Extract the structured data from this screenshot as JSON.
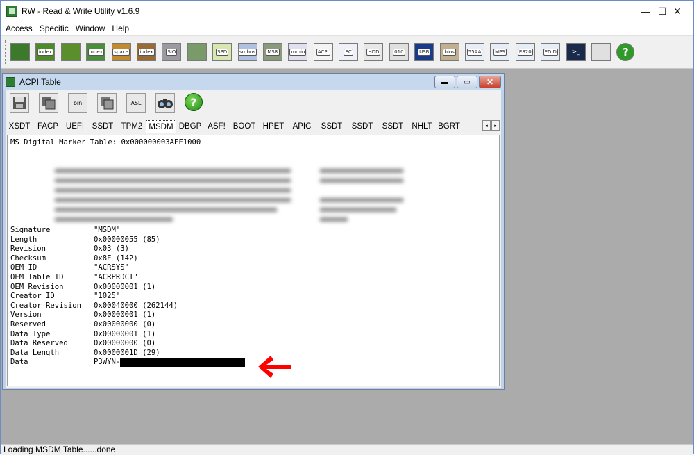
{
  "app": {
    "title": "RW - Read & Write Utility v1.6.9",
    "window_controls": {
      "minimize": "—",
      "maximize": "☐",
      "close": "✕"
    }
  },
  "menu": [
    "Access",
    "Specific",
    "Window",
    "Help"
  ],
  "toolbar": {
    "buttons": [
      {
        "name": "pci",
        "label": ""
      },
      {
        "name": "pci-index",
        "label": "index"
      },
      {
        "name": "memory",
        "label": ""
      },
      {
        "name": "memory-index",
        "label": "index"
      },
      {
        "name": "io-space",
        "label": "space"
      },
      {
        "name": "io-index",
        "label": "index"
      },
      {
        "name": "sio",
        "label": "SIO"
      },
      {
        "name": "ac-power",
        "label": ""
      },
      {
        "name": "spd",
        "label": "SPD"
      },
      {
        "name": "smbus",
        "label": "smbus"
      },
      {
        "name": "msr",
        "label": "MSR"
      },
      {
        "name": "mmio",
        "label": "mmio"
      },
      {
        "name": "acpi",
        "label": "ACPI"
      },
      {
        "name": "ec",
        "label": "EC"
      },
      {
        "name": "hdd",
        "label": "HDD"
      },
      {
        "name": "cmos",
        "label": "010"
      },
      {
        "name": "usb",
        "label": "USB"
      },
      {
        "name": "smbios",
        "label": "bios"
      },
      {
        "name": "55aa",
        "label": "55AA"
      },
      {
        "name": "mps",
        "label": "MPS"
      },
      {
        "name": "e820",
        "label": "E820"
      },
      {
        "name": "edid",
        "label": "EDID"
      },
      {
        "name": "console",
        "label": ">_"
      },
      {
        "name": "dimm",
        "label": ""
      },
      {
        "name": "help",
        "label": "?"
      }
    ]
  },
  "acpi_window": {
    "title": "ACPI Table",
    "tools": [
      "save",
      "copy",
      "bin",
      "bin-copy",
      "ASL",
      "find",
      "help"
    ],
    "tools_text": {
      "bin": "bin",
      "asl": "ASL",
      "help": "?"
    },
    "tabs": [
      "XSDT",
      "FACP",
      "UEFI",
      "SSDT",
      "TPM2",
      "MSDM",
      "DBGP",
      "ASF!",
      "BOOT",
      "HPET",
      "APIC",
      "SSDT",
      "SSDT",
      "SSDT",
      "NHLT",
      "BGRT"
    ],
    "active_tab": "MSDM",
    "scroll_left": "◂",
    "scroll_right": "▸",
    "header_line": "MS Digital Marker Table: 0x000000003AEF1000",
    "fields": [
      {
        "key": "Signature",
        "value": "\"MSDM\""
      },
      {
        "key": "Length",
        "value": "0x00000055 (85)"
      },
      {
        "key": "Revision",
        "value": "0x03 (3)"
      },
      {
        "key": "Checksum",
        "value": "0x8E (142)"
      },
      {
        "key": "OEM ID",
        "value": "\"ACRSYS\""
      },
      {
        "key": "OEM Table ID",
        "value": "\"ACRPRDCT\""
      },
      {
        "key": "OEM Revision",
        "value": "0x00000001 (1)"
      },
      {
        "key": "Creator ID",
        "value": "\"1025\""
      },
      {
        "key": "Creator Revision",
        "value": "0x00040000 (262144)"
      },
      {
        "key": "Version",
        "value": "0x00000001 (1)"
      },
      {
        "key": "Reserved",
        "value": "0x00000000 (0)"
      },
      {
        "key": "Data Type",
        "value": "0x00000001 (1)"
      },
      {
        "key": "Data Reserved",
        "value": "0x00000000 (0)"
      },
      {
        "key": "Data Length",
        "value": "0x0000001D (29)"
      },
      {
        "key": "Data",
        "value": "P3WYN-"
      }
    ]
  },
  "colors": {
    "arrow": "#ff0000",
    "redaction": "#000000"
  },
  "status": "Loading MSDM Table......done"
}
